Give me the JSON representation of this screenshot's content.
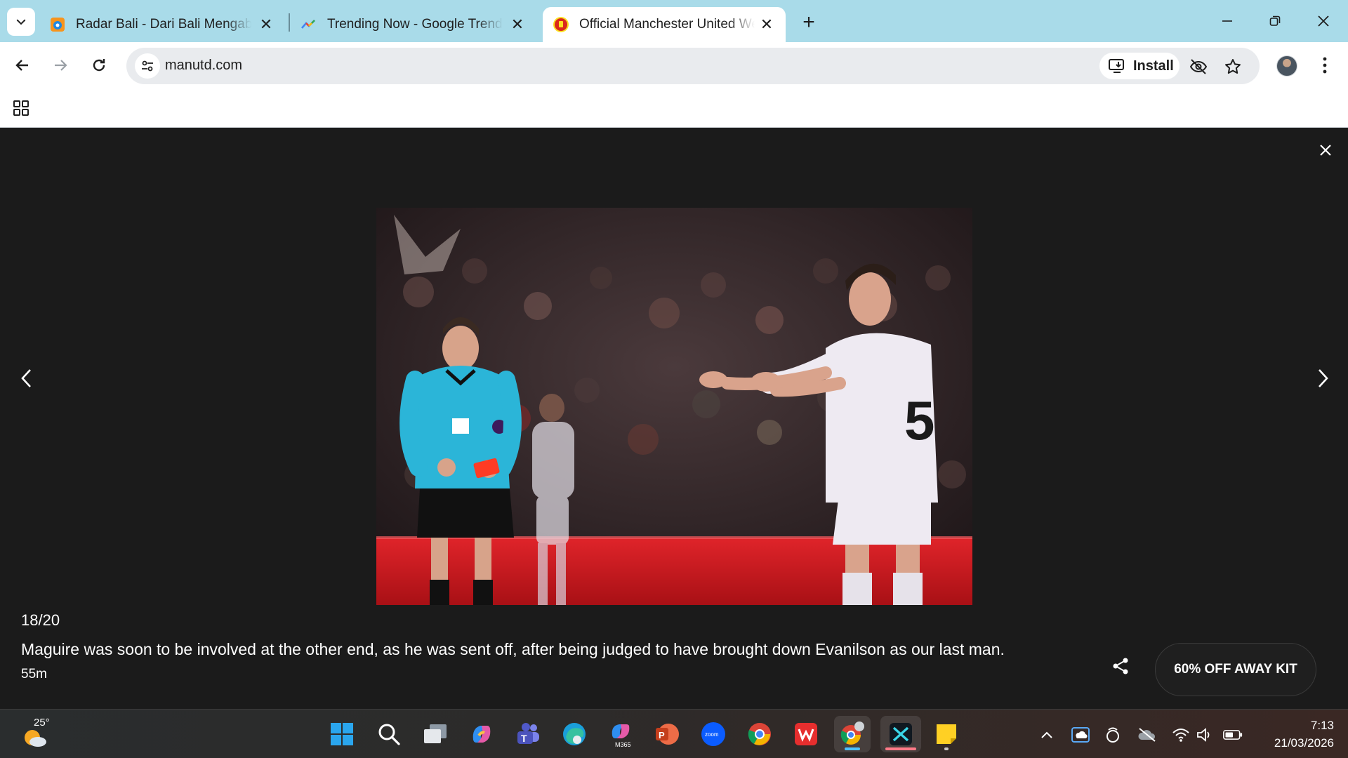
{
  "browser": {
    "tabs": [
      {
        "title": "Radar Bali - Dari Bali Mengabarkan",
        "favicon": "radar-bali-icon",
        "active": false
      },
      {
        "title": "Trending Now - Google Trends",
        "favicon": "google-trends-icon",
        "active": false
      },
      {
        "title": "Official Manchester United Website",
        "favicon": "man-utd-crest-icon",
        "active": true
      }
    ],
    "url": "manutd.com",
    "install_label": "Install"
  },
  "lightbox": {
    "counter": "18/20",
    "caption": "Maguire was soon to be involved at the other end, as he was sent off, after being judged to have brought down Evanilson as our last man.",
    "credit": "55m",
    "promo_label": "60% OFF AWAY KIT"
  },
  "taskbar": {
    "weather_temp": "25°",
    "time": "7:13",
    "date": "21/03/2026",
    "apps": [
      "start",
      "search",
      "task-view",
      "copilot",
      "teams",
      "edge",
      "m365",
      "powerpoint",
      "zoom",
      "chrome",
      "wps",
      "chrome-profile",
      "capcut",
      "sticky-notes"
    ]
  },
  "colors": {
    "tabstrip": "#a9dbe9",
    "viewer_bg": "#1b1b1b",
    "referee_shirt": "#2bb5d8",
    "accent_red": "#da291c"
  }
}
